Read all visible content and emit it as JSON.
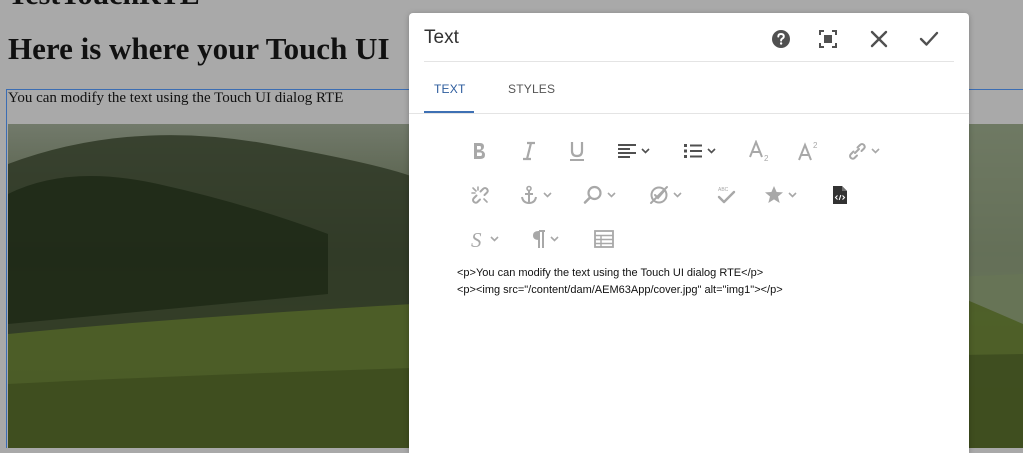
{
  "page": {
    "title": "TestTouchRTE",
    "heading": "Here is where your Touch UI",
    "paragraph": "You can modify the text using the Touch UI dialog RTE"
  },
  "dialog": {
    "title": "Text",
    "actions": [
      "help-icon",
      "fullscreen-icon",
      "close-icon",
      "check-icon"
    ],
    "tabs": [
      {
        "label": "TEXT",
        "active": true
      },
      {
        "label": "STYLES",
        "active": false
      }
    ],
    "toolbar": {
      "row1": [
        "bold-icon",
        "italic-icon",
        "underline-icon",
        "justify-icon",
        "list-icon",
        "subscript-icon",
        "superscript-icon",
        "link-icon"
      ],
      "row2": [
        "unlink-icon",
        "anchor-icon",
        "find-replace-icon",
        "spellcheck-icon",
        "check-spelling-icon",
        "special-chars-icon",
        "source-edit-icon"
      ],
      "row3": [
        "styles-icon",
        "paragraph-format-icon",
        "table-icon"
      ]
    },
    "source": {
      "line1": "<p>You can modify the text using the Touch UI dialog RTE</p>",
      "line2": "<p><img src=\"/content/dam/AEM63App/cover.jpg\" alt=\"img1\"></p>"
    }
  },
  "colors": {
    "accent": "#2d5c9d",
    "icon": "#505050",
    "disabled_icon": "#a8a8a8",
    "page_background": "#a9a9a9"
  }
}
